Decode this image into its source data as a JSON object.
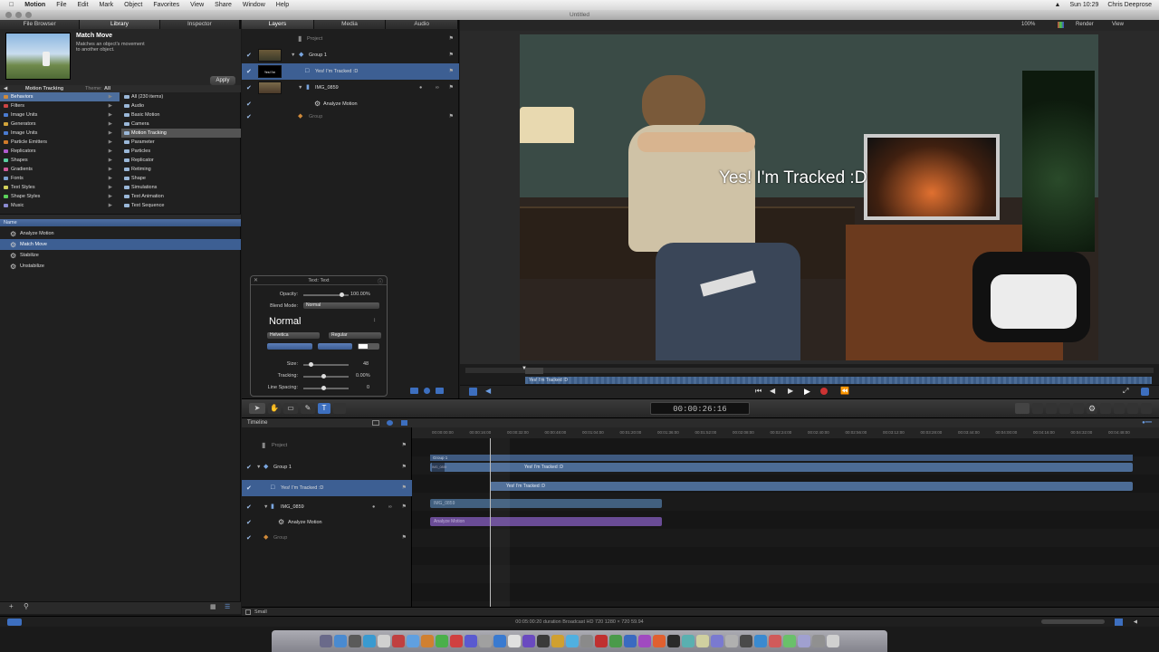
{
  "menubar": {
    "app": "Motion",
    "items": [
      "File",
      "Edit",
      "Mark",
      "Object",
      "Favorites",
      "View",
      "Share",
      "Window",
      "Help"
    ],
    "clock": "Sun 10:29",
    "user": "Chris Deeprose"
  },
  "window": {
    "title": "Untitled"
  },
  "library": {
    "tabs": [
      "File Browser",
      "Library",
      "Inspector"
    ],
    "preview": {
      "title": "Match Move",
      "description": "Matches an object's movement to another object.",
      "apply": "Apply"
    },
    "header": {
      "folder": "Motion Tracking",
      "theme_label": "Theme:",
      "theme_value": "All"
    },
    "categories": [
      {
        "label": "Behaviors",
        "color": "#d08a3a"
      },
      {
        "label": "Filters",
        "color": "#c44"
      },
      {
        "label": "Image Units",
        "color": "#4a7bd1"
      },
      {
        "label": "Generators",
        "color": "#d1a33a"
      },
      {
        "label": "Image Units",
        "color": "#4a7bd1"
      },
      {
        "label": "Particle Emitters",
        "color": "#d07a2a"
      },
      {
        "label": "Replicators",
        "color": "#b05ad0"
      },
      {
        "label": "Shapes",
        "color": "#5ad0a0"
      },
      {
        "label": "Gradients",
        "color": "#d05a9a"
      },
      {
        "label": "Fonts",
        "color": "#7aa0d0"
      },
      {
        "label": "Text Styles",
        "color": "#d0d05a"
      },
      {
        "label": "Shape Styles",
        "color": "#5ad05a"
      },
      {
        "label": "Music",
        "color": "#8a8ad0"
      }
    ],
    "subcategories": [
      "All (230 items)",
      "Audio",
      "Basic Motion",
      "Camera",
      "Motion Tracking",
      "Parameter",
      "Particles",
      "Replicator",
      "Retiming",
      "Shape",
      "Simulations",
      "Text Animation",
      "Text Sequence"
    ],
    "list_header": "Name",
    "items": [
      "Analyze Motion",
      "Match Move",
      "Stabilize",
      "Unstabilize"
    ]
  },
  "layers": {
    "tabs": [
      "Layers",
      "Media",
      "Audio"
    ],
    "rows": [
      "Project",
      "Group 1",
      "Yes! I'm Tracked :D",
      "IMG_0859",
      "Analyze Motion",
      "Group"
    ],
    "thumb_text": "Yes! I'm Tracked"
  },
  "hud": {
    "title": "Text: Text",
    "opacity_label": "Opacity:",
    "opacity_value": "100.00%",
    "blend_label": "Blend Mode:",
    "blend_value": "Normal",
    "style_value": "Normal",
    "font": "Helvetica",
    "weight": "Regular",
    "size_label": "Size:",
    "size_value": "48",
    "tracking_label": "Tracking:",
    "tracking_value": "0.00%",
    "spacing_label": "Line Spacing:",
    "spacing_value": "0"
  },
  "canvas": {
    "zoom": "100%",
    "render": "Render",
    "view": "View",
    "overlay_text": "Yes! I'm Tracked :D",
    "mini_clip": "Yes! I'm Tracked :D"
  },
  "timecode": "00:00:26:16",
  "timeline": {
    "title": "Timeline",
    "layers": [
      "Project",
      "Group 1",
      "Yes! I'm Tracked :D",
      "IMG_0859",
      "Analyze Motion",
      "Group"
    ],
    "ruler": [
      "00:00:00:00",
      "00:00:16:00",
      "00:00:32:00",
      "00:00:48:00",
      "00:01:04:00",
      "00:01:20:00",
      "00:01:36:00",
      "00:01:52:00",
      "00:02:08:00",
      "00:02:24:00",
      "00:02:40:00",
      "00:02:56:00",
      "00:03:12:00",
      "00:03:28:00",
      "00:03:44:00",
      "00:04:00:00",
      "00:04:16:00",
      "00:04:32:00",
      "00:04:48:00"
    ],
    "group_bar": "Group 1",
    "img_small": "IMG_0859",
    "text_bar": "Yes! I'm Tracked :D",
    "img_bar": "IMG_0859",
    "analyze_bar": "Analyze Motion",
    "size_label": "Small"
  },
  "status": "00:05:00:20 duration  Broadcast HD 720  1280 × 720  59.94",
  "colors": {
    "selection": "#3d5f93",
    "bar_blue": "#4c6c96",
    "bar_purple": "#6a4c96"
  }
}
